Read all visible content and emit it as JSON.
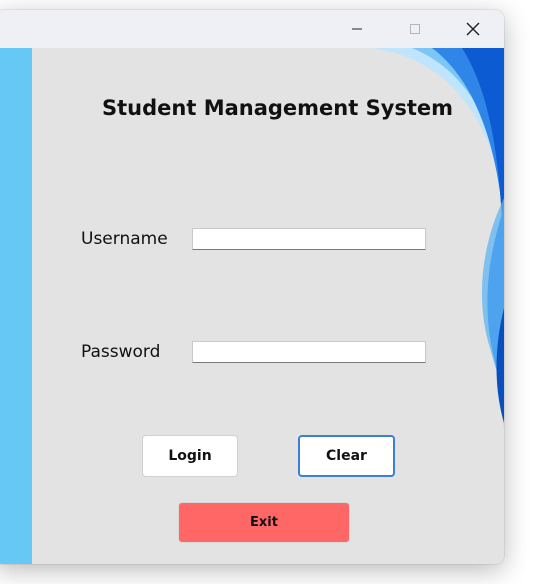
{
  "window": {
    "controls": {
      "minimize_glyph": "─",
      "maximize_glyph": "☐",
      "close_glyph": "✕"
    }
  },
  "app": {
    "title": "Student Management System"
  },
  "form": {
    "username_label": "Username",
    "username_value": "",
    "password_label": "Password",
    "password_value": ""
  },
  "buttons": {
    "login_label": "Login",
    "clear_label": "Clear",
    "exit_label": "Exit"
  },
  "colors": {
    "side_strip": "#66c9f5",
    "background": "#e3e3e3",
    "exit_button": "#ff6666",
    "clear_border": "#3b7fd6",
    "wave_blue": "#1e6fe0"
  },
  "icons": {
    "minimize": "minimize-icon",
    "maximize": "maximize-icon",
    "close": "close-icon"
  }
}
